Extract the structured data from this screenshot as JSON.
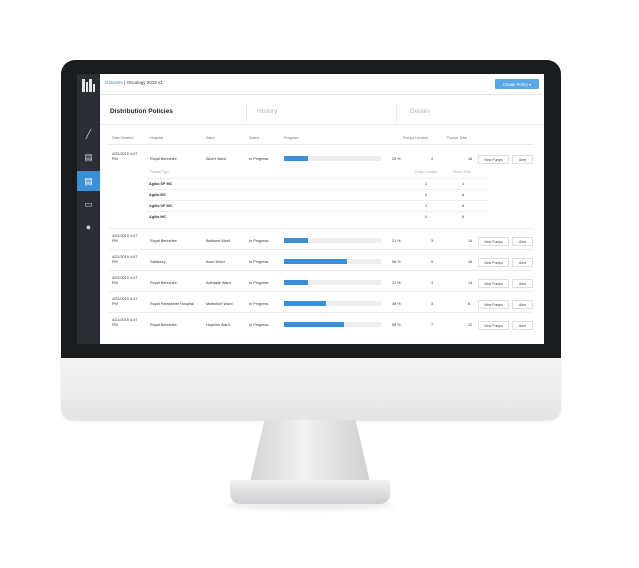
{
  "app": {
    "breadcrumb_link": "Datasets",
    "breadcrumb_current": "| Oncology 2019 v1",
    "create_button": "Create Policy  ▾"
  },
  "tabs": [
    {
      "label": "Distribution Policies"
    },
    {
      "label": "History"
    },
    {
      "label": "Details"
    }
  ],
  "table": {
    "headers": [
      "Date Created",
      "Hospital",
      "Ward",
      "Status",
      "Progress",
      "Pumps Located",
      "Pumps Total"
    ],
    "view_label": "View Pumps",
    "alert_label": "Alert",
    "rows": [
      {
        "date": "4/22/2019 4:47 PM",
        "hospital": "Royal Berkshire",
        "ward": "Albert Ward",
        "status": "In Progress",
        "progress": 0.25,
        "pct": "25 %",
        "located": "4",
        "total": "16"
      },
      {
        "date": "4/22/2019 4:47 PM",
        "hospital": "Royal Berkshire",
        "ward": "Bathurst Ward",
        "status": "In Progress",
        "progress": 0.25,
        "pct": "21 %",
        "located": "3",
        "total": "14"
      },
      {
        "date": "4/22/2019 4:47 PM",
        "hospital": "Salisbury",
        "ward": "Avon Ward",
        "status": "In Progress",
        "progress": 0.65,
        "pct": "56 %",
        "located": "9",
        "total": "16"
      },
      {
        "date": "4/22/2019 4:47 PM",
        "hospital": "Royal Berkshire",
        "ward": "Adelaide Ward",
        "status": "In Progress",
        "progress": 0.25,
        "pct": "21 %",
        "located": "3",
        "total": "14"
      },
      {
        "date": "4/22/2019 4:47 PM",
        "hospital": "Royal Hampshire Hospital",
        "ward": "Mottisfont Ward",
        "status": "In Progress",
        "progress": 0.43,
        "pct": "38 %",
        "located": "3",
        "total": "8"
      },
      {
        "date": "4/22/2019 4:47 PM",
        "hospital": "Royal Berkshire",
        "ward": "Hopkins Ward",
        "status": "In Progress",
        "progress": 0.62,
        "pct": "58 %",
        "located": "7",
        "total": "12"
      }
    ],
    "subtable": {
      "headers": [
        "Product Type",
        "Pumps Located",
        "Pumps Total"
      ],
      "rows": [
        {
          "name": "Agilia SP MC",
          "located": "1",
          "total": "1"
        },
        {
          "name": "Agilia MC",
          "located": "2",
          "total": "6"
        },
        {
          "name": "Agilia SP MC",
          "located": "1",
          "total": "6"
        },
        {
          "name": "Agilia MC",
          "located": "0",
          "total": "6"
        }
      ]
    }
  },
  "sidebar": {
    "items": [
      {
        "icon": "chart-icon",
        "glyph": "╱"
      },
      {
        "icon": "document-icon",
        "glyph": "▤"
      },
      {
        "icon": "file-icon",
        "glyph": "▤"
      },
      {
        "icon": "monitor-icon",
        "glyph": "▭"
      },
      {
        "icon": "settings-icon",
        "glyph": "●"
      }
    ]
  },
  "colors": {
    "accent": "#3a8fd6",
    "sidebar": "#2b2e33"
  }
}
